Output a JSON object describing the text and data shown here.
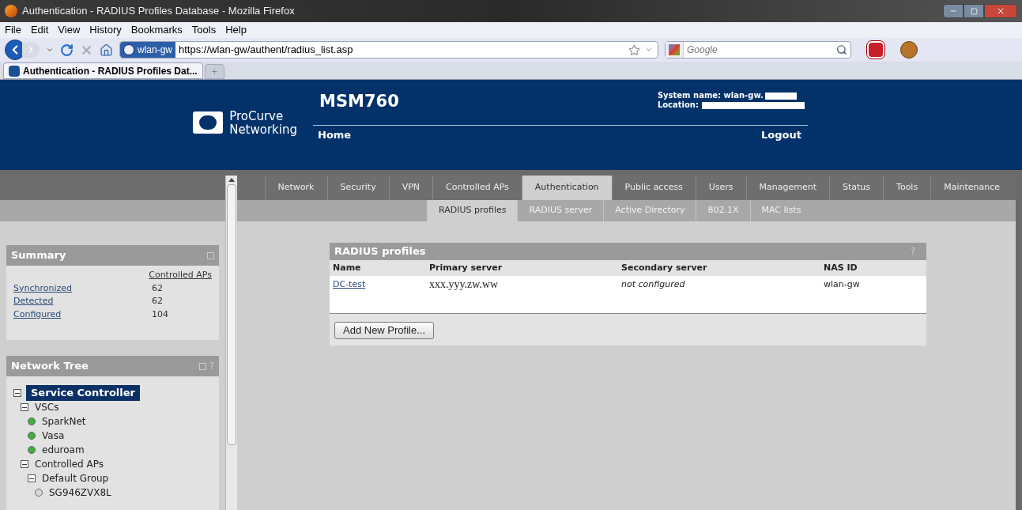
{
  "window": {
    "title": "Authentication - RADIUS Profiles Database - Mozilla Firefox"
  },
  "menu": [
    "File",
    "Edit",
    "View",
    "History",
    "Bookmarks",
    "Tools",
    "Help"
  ],
  "address_bar": {
    "site_badge": "wlan-gw",
    "url": "https://wlan-gw/authent/radius_list.asp"
  },
  "search": {
    "placeholder": "Google"
  },
  "tabs": [
    {
      "label": "Authentication - RADIUS Profiles Dat...",
      "selected": true
    },
    {
      "label": "+",
      "selected": false
    }
  ],
  "header": {
    "brand": [
      "ProCurve",
      "Networking"
    ],
    "product": "MSM760",
    "system_name": "System name: wlan-gw.",
    "location": "Location:",
    "home": "Home",
    "logout": "Logout"
  },
  "nav": [
    {
      "label": "Network",
      "selected": false
    },
    {
      "label": "Security",
      "selected": false
    },
    {
      "label": "VPN",
      "selected": false
    },
    {
      "label": "Controlled APs",
      "selected": false
    },
    {
      "label": "Authentication",
      "selected": true
    },
    {
      "label": "Public access",
      "selected": false
    },
    {
      "label": "Users",
      "selected": false
    },
    {
      "label": "Management",
      "selected": false
    },
    {
      "label": "Status",
      "selected": false
    },
    {
      "label": "Tools",
      "selected": false
    },
    {
      "label": "Maintenance",
      "selected": false
    }
  ],
  "subnav": [
    {
      "label": "RADIUS profiles",
      "selected": true
    },
    {
      "label": "RADIUS server",
      "selected": false
    },
    {
      "label": "Active Directory",
      "selected": false
    },
    {
      "label": "802.1X",
      "selected": false
    },
    {
      "label": "MAC lists",
      "selected": false
    }
  ],
  "summary": {
    "title": "Summary",
    "column": "Controlled APs",
    "rows": [
      {
        "label": "Synchronized",
        "value": "62"
      },
      {
        "label": "Detected",
        "value": "62"
      },
      {
        "label": "Configured",
        "value": "104"
      }
    ]
  },
  "network_tree": {
    "title": "Network Tree",
    "help": "?",
    "nodes": [
      {
        "label": "Service Controller",
        "selected": true,
        "expanded": true,
        "children": [
          {
            "label": "VSCs",
            "selected": false,
            "expanded": true,
            "children": [
              {
                "label": "SparkNet",
                "selected": false,
                "color": "#3fae3f"
              },
              {
                "label": "Vasa",
                "selected": false,
                "color": "#3fae3f"
              },
              {
                "label": "eduroam",
                "selected": false,
                "color": "#3fae3f"
              }
            ]
          },
          {
            "label": "Controlled APs",
            "selected": false,
            "expanded": true,
            "children": [
              {
                "label": "Default Group",
                "selected": false,
                "expanded": true,
                "children": [
                  {
                    "label": "SG946ZVX8L",
                    "selected": false,
                    "color": "#d8d8d8"
                  }
                ]
              }
            ]
          }
        ]
      }
    ]
  },
  "radius_profiles": {
    "title": "RADIUS profiles",
    "help": "?",
    "columns": [
      "Name",
      "Primary server",
      "Secondary server",
      "NAS ID"
    ],
    "rows": [
      {
        "name": "DC-test",
        "primary": "xxx.yyy.zw.ww",
        "secondary": "not configured",
        "nas_id": "wlan-gw"
      }
    ],
    "add_button": "Add New Profile..."
  }
}
